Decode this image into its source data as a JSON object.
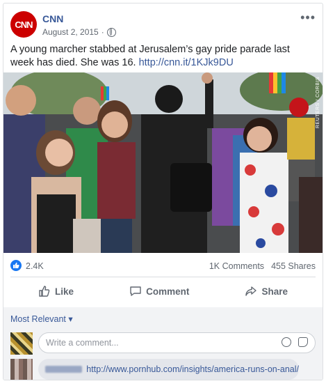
{
  "post": {
    "page_name": "CNN",
    "logo_text": "CNN",
    "date": "August 2, 2015",
    "separator": "·",
    "more": "•••",
    "text": "A young marcher stabbed at Jerusalem’s gay pride parade last week has died. She was 16.",
    "link": "http://cnn.it/1KJk9DU",
    "watermark": "REUTERS / CORBIS"
  },
  "stats": {
    "likes": "2.4K",
    "comments": "1K Comments",
    "shares": "455 Shares"
  },
  "actions": {
    "like": "Like",
    "comment": "Comment",
    "share": "Share"
  },
  "comments": {
    "sort_label": "Most Relevant",
    "input_placeholder": "Write a comment...",
    "first_comment_link": "http://www.pornhub.com/insights/america-runs-on-anal/"
  },
  "colors": {
    "brand": "#cc0000",
    "link": "#385898",
    "like_blue": "#1877f2"
  }
}
